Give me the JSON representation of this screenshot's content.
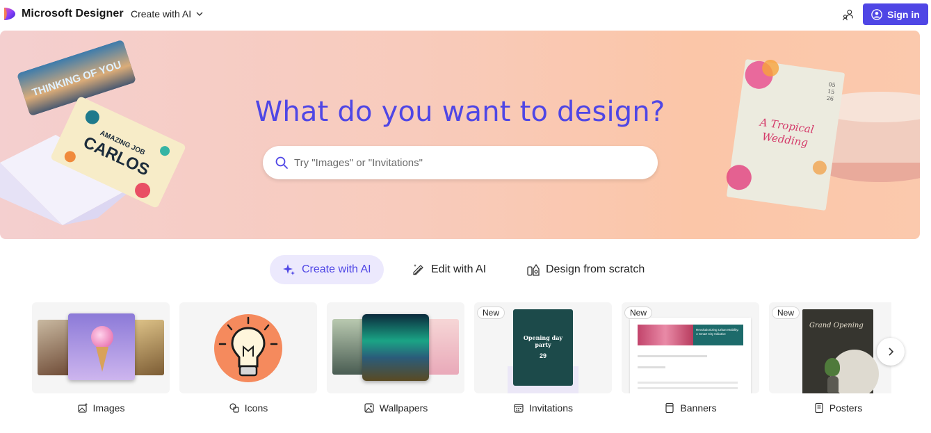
{
  "header": {
    "brand": "Microsoft Designer",
    "create_menu_label": "Create with AI",
    "signin_label": "Sign in"
  },
  "hero": {
    "title": "What do you want to design?",
    "search_placeholder": "Try \"Images\" or \"Invitations\"",
    "search_value": "",
    "art_left_card_text": "THINKING OF YOU",
    "art_left_card2_line1": "AMAZING JOB",
    "art_left_card2_line2": "CARLOS",
    "art_right_title": "A Tropical Wedding",
    "art_right_dates": [
      "05",
      "15",
      "26"
    ]
  },
  "mode_tabs": [
    {
      "label": "Create with AI",
      "active": true
    },
    {
      "label": "Edit with AI",
      "active": false
    },
    {
      "label": "Design from scratch",
      "active": false
    }
  ],
  "categories": [
    {
      "label": "Images",
      "badge": ""
    },
    {
      "label": "Icons",
      "badge": ""
    },
    {
      "label": "Wallpapers",
      "badge": ""
    },
    {
      "label": "Invitations",
      "badge": "New",
      "thumb_text": "Opening day party",
      "thumb_num": "29"
    },
    {
      "label": "Banners",
      "badge": "New",
      "thumb_text": "Revolutionizing Urban Mobility: A Smart City Initiative"
    },
    {
      "label": "Posters",
      "badge": "New",
      "thumb_text": "Grand Opening"
    }
  ],
  "colors": {
    "accent": "#4f46e5",
    "active_tab_bg": "#ece9fd",
    "card_bg": "#f5f5f5"
  }
}
